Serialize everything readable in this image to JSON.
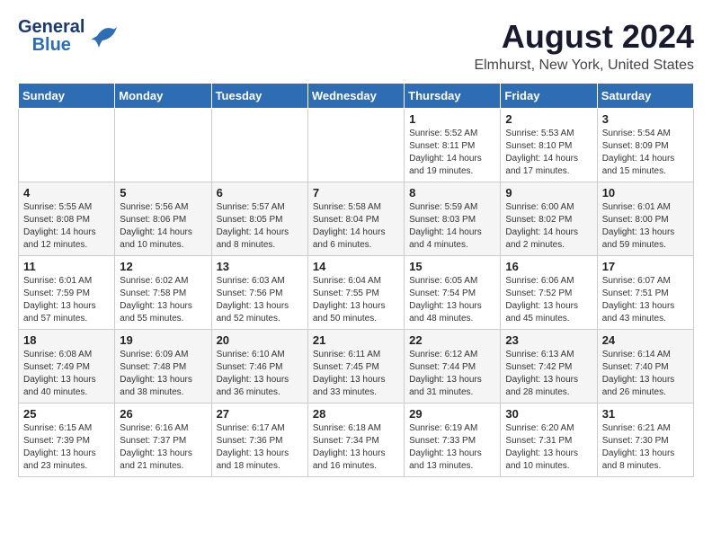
{
  "header": {
    "logo_line1": "General",
    "logo_line2": "Blue",
    "month_year": "August 2024",
    "location": "Elmhurst, New York, United States"
  },
  "weekdays": [
    "Sunday",
    "Monday",
    "Tuesday",
    "Wednesday",
    "Thursday",
    "Friday",
    "Saturday"
  ],
  "weeks": [
    [
      {
        "day": "",
        "info": ""
      },
      {
        "day": "",
        "info": ""
      },
      {
        "day": "",
        "info": ""
      },
      {
        "day": "",
        "info": ""
      },
      {
        "day": "1",
        "info": "Sunrise: 5:52 AM\nSunset: 8:11 PM\nDaylight: 14 hours\nand 19 minutes."
      },
      {
        "day": "2",
        "info": "Sunrise: 5:53 AM\nSunset: 8:10 PM\nDaylight: 14 hours\nand 17 minutes."
      },
      {
        "day": "3",
        "info": "Sunrise: 5:54 AM\nSunset: 8:09 PM\nDaylight: 14 hours\nand 15 minutes."
      }
    ],
    [
      {
        "day": "4",
        "info": "Sunrise: 5:55 AM\nSunset: 8:08 PM\nDaylight: 14 hours\nand 12 minutes."
      },
      {
        "day": "5",
        "info": "Sunrise: 5:56 AM\nSunset: 8:06 PM\nDaylight: 14 hours\nand 10 minutes."
      },
      {
        "day": "6",
        "info": "Sunrise: 5:57 AM\nSunset: 8:05 PM\nDaylight: 14 hours\nand 8 minutes."
      },
      {
        "day": "7",
        "info": "Sunrise: 5:58 AM\nSunset: 8:04 PM\nDaylight: 14 hours\nand 6 minutes."
      },
      {
        "day": "8",
        "info": "Sunrise: 5:59 AM\nSunset: 8:03 PM\nDaylight: 14 hours\nand 4 minutes."
      },
      {
        "day": "9",
        "info": "Sunrise: 6:00 AM\nSunset: 8:02 PM\nDaylight: 14 hours\nand 2 minutes."
      },
      {
        "day": "10",
        "info": "Sunrise: 6:01 AM\nSunset: 8:00 PM\nDaylight: 13 hours\nand 59 minutes."
      }
    ],
    [
      {
        "day": "11",
        "info": "Sunrise: 6:01 AM\nSunset: 7:59 PM\nDaylight: 13 hours\nand 57 minutes."
      },
      {
        "day": "12",
        "info": "Sunrise: 6:02 AM\nSunset: 7:58 PM\nDaylight: 13 hours\nand 55 minutes."
      },
      {
        "day": "13",
        "info": "Sunrise: 6:03 AM\nSunset: 7:56 PM\nDaylight: 13 hours\nand 52 minutes."
      },
      {
        "day": "14",
        "info": "Sunrise: 6:04 AM\nSunset: 7:55 PM\nDaylight: 13 hours\nand 50 minutes."
      },
      {
        "day": "15",
        "info": "Sunrise: 6:05 AM\nSunset: 7:54 PM\nDaylight: 13 hours\nand 48 minutes."
      },
      {
        "day": "16",
        "info": "Sunrise: 6:06 AM\nSunset: 7:52 PM\nDaylight: 13 hours\nand 45 minutes."
      },
      {
        "day": "17",
        "info": "Sunrise: 6:07 AM\nSunset: 7:51 PM\nDaylight: 13 hours\nand 43 minutes."
      }
    ],
    [
      {
        "day": "18",
        "info": "Sunrise: 6:08 AM\nSunset: 7:49 PM\nDaylight: 13 hours\nand 40 minutes."
      },
      {
        "day": "19",
        "info": "Sunrise: 6:09 AM\nSunset: 7:48 PM\nDaylight: 13 hours\nand 38 minutes."
      },
      {
        "day": "20",
        "info": "Sunrise: 6:10 AM\nSunset: 7:46 PM\nDaylight: 13 hours\nand 36 minutes."
      },
      {
        "day": "21",
        "info": "Sunrise: 6:11 AM\nSunset: 7:45 PM\nDaylight: 13 hours\nand 33 minutes."
      },
      {
        "day": "22",
        "info": "Sunrise: 6:12 AM\nSunset: 7:44 PM\nDaylight: 13 hours\nand 31 minutes."
      },
      {
        "day": "23",
        "info": "Sunrise: 6:13 AM\nSunset: 7:42 PM\nDaylight: 13 hours\nand 28 minutes."
      },
      {
        "day": "24",
        "info": "Sunrise: 6:14 AM\nSunset: 7:40 PM\nDaylight: 13 hours\nand 26 minutes."
      }
    ],
    [
      {
        "day": "25",
        "info": "Sunrise: 6:15 AM\nSunset: 7:39 PM\nDaylight: 13 hours\nand 23 minutes."
      },
      {
        "day": "26",
        "info": "Sunrise: 6:16 AM\nSunset: 7:37 PM\nDaylight: 13 hours\nand 21 minutes."
      },
      {
        "day": "27",
        "info": "Sunrise: 6:17 AM\nSunset: 7:36 PM\nDaylight: 13 hours\nand 18 minutes."
      },
      {
        "day": "28",
        "info": "Sunrise: 6:18 AM\nSunset: 7:34 PM\nDaylight: 13 hours\nand 16 minutes."
      },
      {
        "day": "29",
        "info": "Sunrise: 6:19 AM\nSunset: 7:33 PM\nDaylight: 13 hours\nand 13 minutes."
      },
      {
        "day": "30",
        "info": "Sunrise: 6:20 AM\nSunset: 7:31 PM\nDaylight: 13 hours\nand 10 minutes."
      },
      {
        "day": "31",
        "info": "Sunrise: 6:21 AM\nSunset: 7:30 PM\nDaylight: 13 hours\nand 8 minutes."
      }
    ]
  ]
}
